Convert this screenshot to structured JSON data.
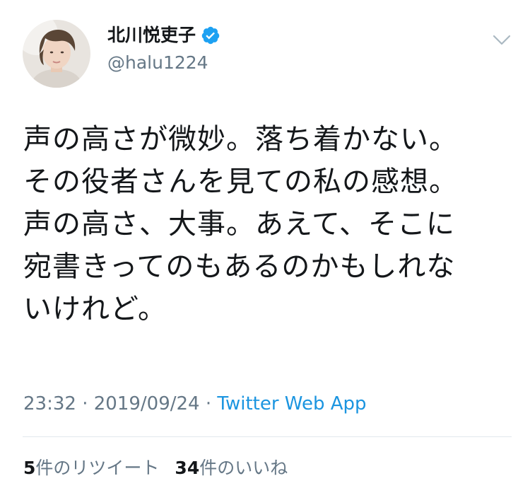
{
  "author": {
    "display_name": "北川悦吏子",
    "handle": "@halu1224",
    "verified": true,
    "avatar_icon": "profile-photo",
    "verified_icon": "verified-badge-icon",
    "menu_icon": "chevron-down-icon"
  },
  "tweet": {
    "lines": [
      "声の高さが微妙。落ち着かない。",
      "その役者さんを見ての私の感想。",
      "声の高さ、大事。あえて、そこに",
      "宛書きってのもあるのかもしれな",
      "いけれど。"
    ]
  },
  "meta": {
    "time": "23:32",
    "separator1": " · ",
    "date": "2019/09/24",
    "separator2": " · ",
    "source": "Twitter Web App"
  },
  "stats": {
    "retweet_count": "5",
    "retweet_label": "件のリツイート",
    "like_count": "34",
    "like_label": "件のいいね"
  },
  "colors": {
    "text": "#14171a",
    "secondary": "#657786",
    "link": "#1b95e0",
    "verified": "#1da1f2",
    "divider": "#e1e8ed"
  }
}
